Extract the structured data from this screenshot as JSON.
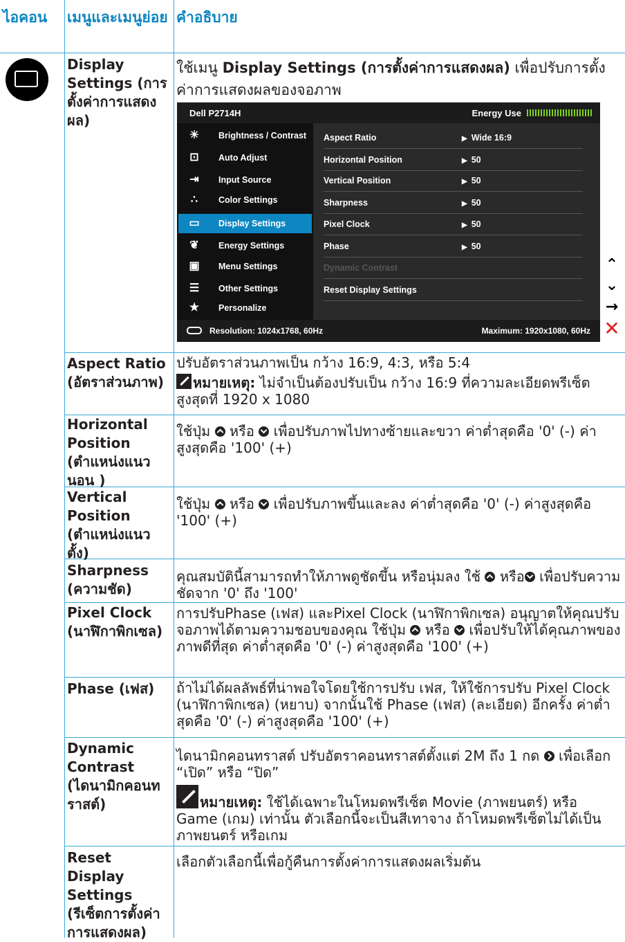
{
  "headers": {
    "icon": "ไอคอน",
    "menu": "เมนูและเมนูย่อย",
    "description": "คำอธิบาย"
  },
  "display_settings": {
    "menu": "Display Settings (การตั้งค่าการแสดงผล)",
    "desc_pre": "ใช้เมนู ",
    "desc_bold": "Display Settings (การตั้งค่าการแสดงผล)",
    "desc_post": " เพื่อปรับการตั้งค่าการแสดงผลของจอภาพ"
  },
  "osd": {
    "title": "Dell P2714H",
    "energy_label": "Energy Use",
    "menu_items": [
      {
        "label": "Brightness / Contrast",
        "icon": "brightness-icon"
      },
      {
        "label": "Auto Adjust",
        "icon": "auto-adjust-icon"
      },
      {
        "label": "Input Source",
        "icon": "input-source-icon"
      },
      {
        "label": "Color Settings",
        "icon": "color-settings-icon"
      },
      {
        "label": "Display Settings",
        "icon": "display-settings-icon"
      },
      {
        "label": "Energy Settings",
        "icon": "energy-settings-icon"
      },
      {
        "label": "Menu Settings",
        "icon": "menu-settings-icon"
      },
      {
        "label": "Other Settings",
        "icon": "other-settings-icon"
      },
      {
        "label": "Personalize",
        "icon": "star-icon"
      }
    ],
    "rows": [
      {
        "label": "Aspect Ratio",
        "value": "Wide 16:9"
      },
      {
        "label": "Horizontal Position",
        "value": "50"
      },
      {
        "label": "Vertical Position",
        "value": "50"
      },
      {
        "label": "Sharpness",
        "value": "50"
      },
      {
        "label": "Pixel Clock",
        "value": "50"
      },
      {
        "label": "Phase",
        "value": "50"
      },
      {
        "label": "Dynamic Contrast"
      },
      {
        "label": "Reset Display Settings"
      }
    ],
    "resolution": "Resolution: 1024x1768, 60Hz",
    "maximum": "Maximum: 1920x1080, 60Hz"
  },
  "rows": {
    "aspect": {
      "menu": "Aspect Ratio (อัตราส่วนภาพ)",
      "desc": "ปรับอัตราส่วนภาพเป็น กว้าง 16:9, 4:3, หรือ 5:4",
      "note_label": "หมายเหตุ:",
      "note": " ไม่จำเป็นต้องปรับเป็น กว้าง 16:9 ที่ความละเอียดพรีเซ็ตสูงสุดที่ 1920 x 1080"
    },
    "horizontal": {
      "menu": "Horizontal Position (ตำแหน่งแนวนอน )",
      "d1": "ใช้ปุ่ม ",
      "d2": " หรือ ",
      "d3": " เพื่อปรับภาพไปทางซ้ายและขวา ค่าต่ำสุดคือ '0' (-) ค่าสูงสุดคือ '100' (+)"
    },
    "vertical": {
      "menu": "Vertical Position (ตำแหน่งแนวตั้ง)",
      "d1": "ใช้ปุ่ม ",
      "d2": " หรือ ",
      "d3": " เพื่อปรับภาพขึ้นและลง ค่าต่ำสุดคือ '0' (-) ค่าสูงสุดคือ '100' (+)"
    },
    "sharpness": {
      "menu": "Sharpness (ความชัด)",
      "d1": "คุณสมบัตินี้สามารถทำให้ภาพดูชัดขึ้น หรือนุ่มลง ใช้ ",
      "d2": " หรือ",
      "d3": " เพื่อปรับความชัดจาก '0' ถึง '100'"
    },
    "pixel_clock": {
      "menu": "Pixel Clock (นาฬิกาพิกเซล)",
      "d1": "การปรับPhase (เฟส) และPixel Clock (นาฬิกาพิกเซล) อนุญาตให้คุณปรับจอภาพได้ตามความชอบของคุณ ใช้ปุ่ม ",
      "d2": " หรือ ",
      "d3": " เพื่อปรับให้ได้คุณภาพของภาพดีที่สุด ค่าต่ำสุดคือ '0' (-) ค่าสูงสุดคือ '100' (+)"
    },
    "phase": {
      "menu": "Phase (เฟส)",
      "desc": "ถ้าไม่ได้ผลลัพธ์ที่น่าพอใจโดยใช้การปรับ เฟส, ให้ใช้การปรับ Pixel Clock (นาฬิกาพิกเซล) (หยาบ) จากนั้นใช้ Phase (เฟส) (ละเอียด) อีกครั้ง ค่าต่ำสุดคือ '0' (-) ค่าสูงสุดคือ '100' (+)"
    },
    "dynamic": {
      "menu": "Dynamic Contrast (ไดนามิกคอนทราสต์)",
      "d1": "ไดนามิกคอนทราสต์ ปรับอัตราคอนทราสต์ตั้งแต่ 2M ถึง 1  กด ",
      "d2": " เพื่อเลือก “เปิด” หรือ “ปิด”",
      "note_label": "หมายเหตุ:",
      "note": " ใช้ได้เฉพาะในโหมดพรีเซ็ต Movie (ภาพยนตร์) หรือ Game (เกม) เท่านั้น ตัวเลือกนี้จะเป็นสีเทาจาง ถ้าโหมดพรีเซ็ตไม่ได้เป็นภาพยนตร์ หรือเกม"
    },
    "reset": {
      "menu": "Reset Display Settings (รีเซ็ตการตั้งค่าการแสดงผล)",
      "desc": "เลือกตัวเลือกนี้เพื่อกู้คืนการตั้งค่าการแสดงผลเริ่มต้น"
    }
  },
  "colors": {
    "accent": "#0d86c2",
    "line": "#3aa8d8"
  }
}
